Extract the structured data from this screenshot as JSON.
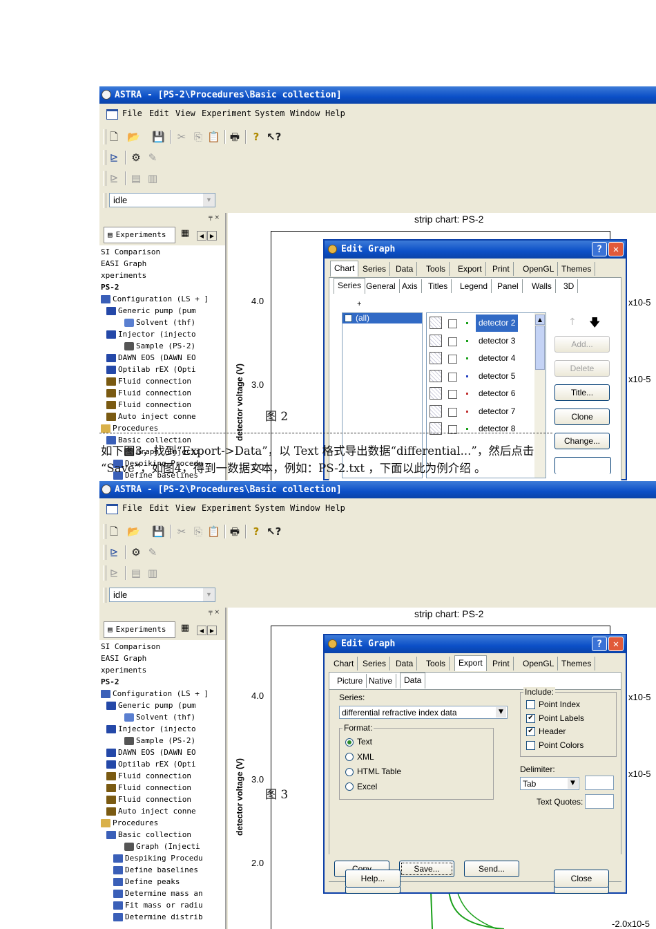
{
  "app": {
    "title": "ASTRA - [PS-2\\Procedures\\Basic collection]",
    "menu": [
      "File",
      "Edit",
      "View",
      "Experiment",
      "System",
      "Window",
      "Help"
    ],
    "status_combo": "idle",
    "panel_tab": "Experiments"
  },
  "tree": [
    "SI Comparison",
    "EASI Graph",
    "xperiments",
    "PS-2",
    "Configuration (LS + ]",
    "Generic pump (pum",
    "Solvent (thf)",
    "Injector (injecto",
    "Sample (PS-2)",
    "DAWN EOS (DAWN EO",
    "Optilab rEX (Opti",
    "Fluid connection",
    "Fluid connection",
    "Fluid connection",
    "Auto inject conne",
    "Procedures",
    "Basic collection",
    "Graph (Injecti",
    "Despiking Procedu",
    "Define baselines",
    "Define peaks",
    "Determine mass an",
    "Fit mass or radiu",
    "Determine distrib"
  ],
  "chart": {
    "title": "strip chart: PS-2",
    "ylabel": "detector voltage (V)",
    "yticks": [
      "4.0",
      "3.0",
      "2.0"
    ],
    "right_ticks_1": [
      "x10-5",
      "x10-5"
    ],
    "right_ticks_2": [
      "x10-5",
      "x10-5",
      "-2.0x10-5"
    ]
  },
  "dialog1": {
    "title": "Edit Graph",
    "tabs": [
      "Chart",
      "Series",
      "Data",
      "Tools",
      "Export",
      "Print",
      "OpenGL",
      "Themes"
    ],
    "subtabs": [
      "Series",
      "General",
      "Axis",
      "Titles",
      "Legend",
      "Panel",
      "Walls",
      "3D"
    ],
    "all_item": "(all)",
    "series": [
      "detector 2",
      "detector 3",
      "detector 4",
      "detector 5",
      "detector 6",
      "detector 7",
      "detector 8"
    ],
    "series_colors": [
      "#1aa01a",
      "#1aa01a",
      "#1aa01a",
      "#2440c0",
      "#c03030",
      "#c03030",
      "#1aa01a"
    ],
    "buttons": {
      "add": "Add...",
      "delete": "Delete",
      "title": "Title...",
      "clone": "Clone",
      "change": "Change..."
    }
  },
  "dialog2": {
    "title": "Edit Graph",
    "tabs": [
      "Chart",
      "Series",
      "Data",
      "Tools",
      "Export",
      "Print",
      "OpenGL",
      "Themes"
    ],
    "subtabs": [
      "Picture",
      "Native",
      "Data"
    ],
    "series_label": "Series:",
    "series_value": "differential refractive index data",
    "format_label": "Format:",
    "formats": [
      "Text",
      "XML",
      "HTML Table",
      "Excel"
    ],
    "selected_format": "Text",
    "include_label": "Include:",
    "include": [
      {
        "label": "Point Index",
        "checked": false
      },
      {
        "label": "Point Labels",
        "checked": true
      },
      {
        "label": "Header",
        "checked": true
      },
      {
        "label": "Point Colors",
        "checked": false
      }
    ],
    "delimiter_label": "Delimiter:",
    "delimiter_value": "Tab",
    "text_quotes_label": "Text Quotes:",
    "buttons": {
      "copy": "Copy",
      "save": "Save...",
      "send": "Send...",
      "help": "Help...",
      "close": "Close"
    }
  },
  "captions": {
    "fig2": "图 2",
    "fig3": "图 3",
    "para_line1": "如下图3，找到“Export->Data”，以 Text 格式导出数据“differential...”，然后点击",
    "para_line2": "“Save”，如图4，得到一数据文本，例如：PS-2.txt ，下面以此为例介绍 。"
  }
}
